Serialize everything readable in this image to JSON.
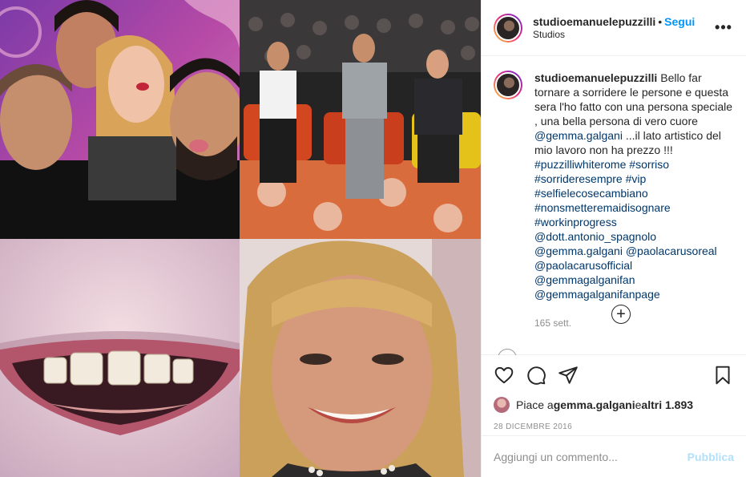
{
  "header": {
    "username": "studioemanuelepuzzilli",
    "separator": "•",
    "follow_label": "Segui",
    "location": "Studios",
    "more_icon": "more-options-icon"
  },
  "caption": {
    "username": "studioemanuelepuzzilli",
    "text_1": "Bello far tornare a sorridere le persone e questa sera l'ho fatto con una persona speciale , una bella persona di vero cuore ",
    "mention_1": "@gemma.galgani",
    "text_2": " ...il lato artistico del mio lavoro non ha prezzo !!! ",
    "tags": [
      "#puzzilliwhiterome",
      "#sorriso",
      "#sorrideresempre",
      "#vip",
      "#selfielecosecambiano",
      "#nonsmetteremaidisognare",
      "#workinprogress"
    ],
    "mentions_2": [
      "@dott.antonio_spagnolo",
      "@gemma.galgani",
      "@paolacarusoreal",
      "@paolacarusofficial",
      "@gemmagalganifan",
      "@gemmagalganifanpage"
    ],
    "time_ago": "165 sett."
  },
  "load_more_icon": "plus-circle-icon",
  "actions": {
    "like_icon": "heart-icon",
    "comment_icon": "comment-icon",
    "share_icon": "share-icon",
    "save_icon": "bookmark-icon"
  },
  "likes": {
    "prefix": "Piace a ",
    "user": "gemma.galgani",
    "middle": " e ",
    "others": "altri 1.893"
  },
  "date": "28 DICEMBRE 2016",
  "comment": {
    "placeholder": "Aggiungi un commento...",
    "publish_label": "Pubblica"
  },
  "colors": {
    "link": "#00376b",
    "follow": "#0095f6",
    "muted": "#8e8e8e",
    "publish_disabled": "#b2dffc"
  }
}
